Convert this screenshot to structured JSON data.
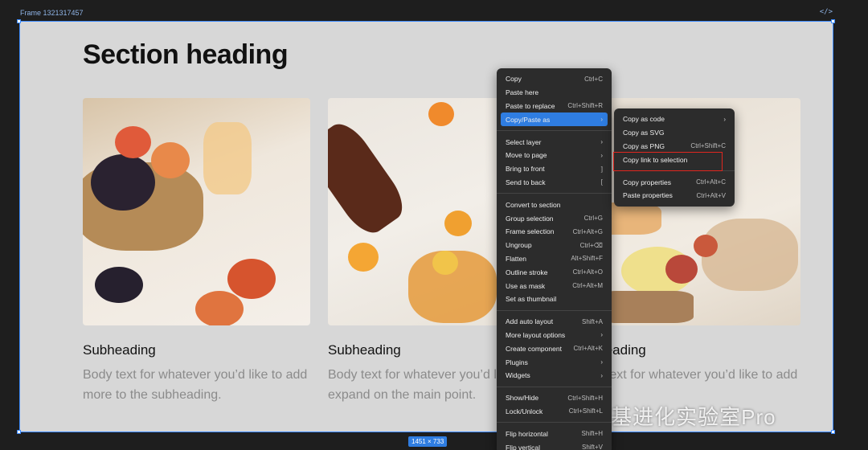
{
  "frame": {
    "label": "Frame 1321317457",
    "size_badge": "1451 × 733",
    "code_icon": "</>"
  },
  "section_heading": "Section heading",
  "cards": [
    {
      "title": "Subheading",
      "body": "Body text for whatever you’d like to add more to the subheading."
    },
    {
      "title": "Subheading",
      "body": "Body text for whatever you’d like to expand on the main point."
    },
    {
      "title": "Subheading",
      "body": "Body text for whatever you’d like to add more."
    }
  ],
  "context_menu": {
    "groups": [
      [
        {
          "label": "Copy",
          "shortcut": "Ctrl+C"
        },
        {
          "label": "Paste here",
          "shortcut": ""
        },
        {
          "label": "Paste to replace",
          "shortcut": "Ctrl+Shift+R"
        },
        {
          "label": "Copy/Paste as",
          "shortcut": "",
          "submenu": true,
          "active": true
        }
      ],
      [
        {
          "label": "Select layer",
          "submenu": true
        },
        {
          "label": "Move to page",
          "submenu": true
        },
        {
          "label": "Bring to front",
          "shortcut": "]"
        },
        {
          "label": "Send to back",
          "shortcut": "["
        }
      ],
      [
        {
          "label": "Convert to section",
          "shortcut": ""
        },
        {
          "label": "Group selection",
          "shortcut": "Ctrl+G"
        },
        {
          "label": "Frame selection",
          "shortcut": "Ctrl+Alt+G"
        },
        {
          "label": "Ungroup",
          "shortcut": "Ctrl+⌫"
        },
        {
          "label": "Flatten",
          "shortcut": "Alt+Shift+F"
        },
        {
          "label": "Outline stroke",
          "shortcut": "Ctrl+Alt+O"
        },
        {
          "label": "Use as mask",
          "shortcut": "Ctrl+Alt+M"
        },
        {
          "label": "Set as thumbnail",
          "shortcut": ""
        }
      ],
      [
        {
          "label": "Add auto layout",
          "shortcut": "Shift+A"
        },
        {
          "label": "More layout options",
          "submenu": true
        },
        {
          "label": "Create component",
          "shortcut": "Ctrl+Alt+K"
        },
        {
          "label": "Plugins",
          "submenu": true
        },
        {
          "label": "Widgets",
          "submenu": true
        }
      ],
      [
        {
          "label": "Show/Hide",
          "shortcut": "Ctrl+Shift+H"
        },
        {
          "label": "Lock/Unlock",
          "shortcut": "Ctrl+Shift+L"
        }
      ],
      [
        {
          "label": "Flip horizontal",
          "shortcut": "Shift+H"
        },
        {
          "label": "Flip vertical",
          "shortcut": "Shift+V"
        }
      ]
    ]
  },
  "submenu": {
    "groups": [
      [
        {
          "label": "Copy as code",
          "submenu": true
        },
        {
          "label": "Copy as SVG",
          "shortcut": ""
        },
        {
          "label": "Copy as PNG",
          "shortcut": "Ctrl+Shift+C"
        },
        {
          "label": "Copy link to selection",
          "shortcut": "",
          "highlighted": true
        }
      ],
      [
        {
          "label": "Copy properties",
          "shortcut": "Ctrl+Alt+C"
        },
        {
          "label": "Paste properties",
          "shortcut": "Ctrl+Alt+V"
        }
      ]
    ]
  },
  "watermark": "公众号 · 硅基进化实验室Pro",
  "colors": {
    "accent": "#2f7de1",
    "selection": "#3d8bfd",
    "highlight": "#e0261f"
  }
}
